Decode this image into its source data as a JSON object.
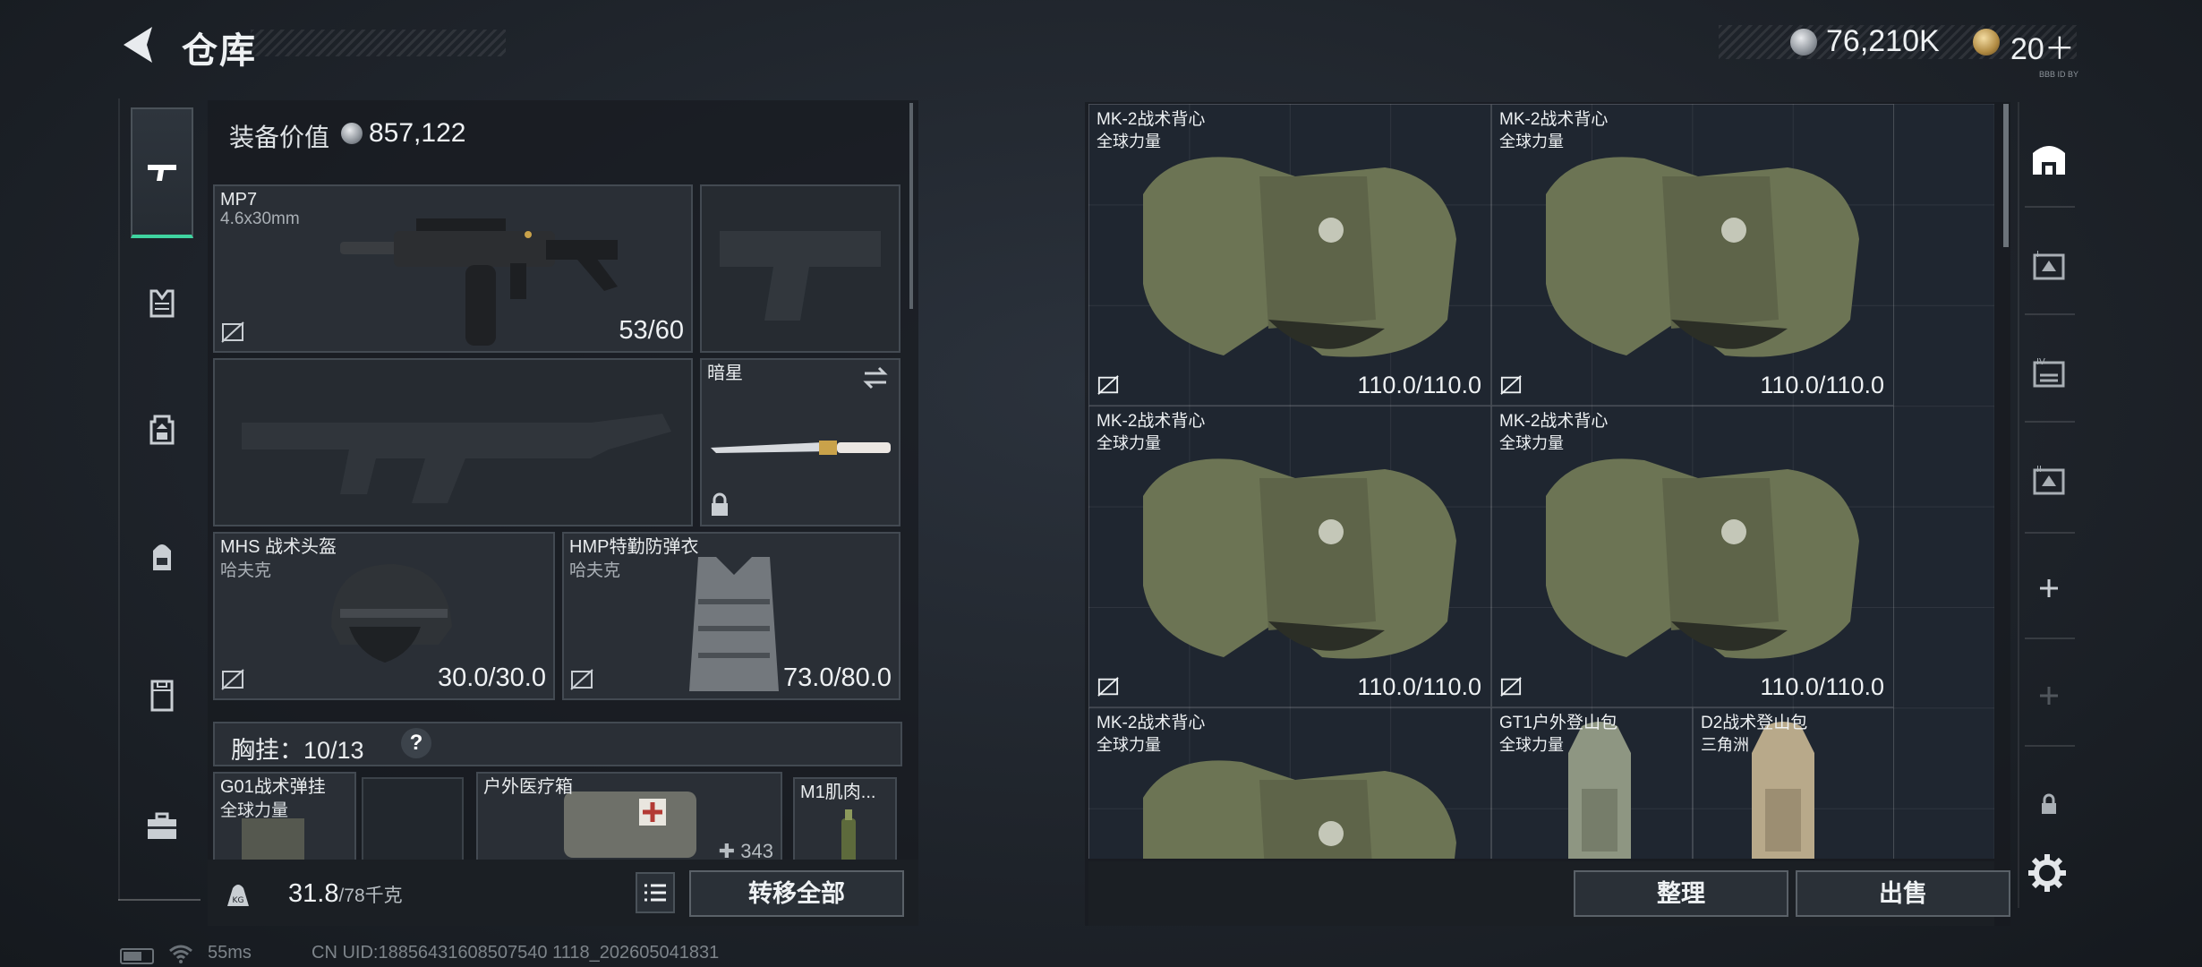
{
  "header": {
    "title": "仓库",
    "currency_amount": "76,210K",
    "coupon_amount": "20＋",
    "tiny_label": "BBB ID BY"
  },
  "left_nav": {
    "items": [
      "weapon-icon",
      "vest-icon",
      "rig-icon",
      "backpack-icon",
      "container-icon",
      "toolbox-icon"
    ],
    "selected": "weapon-icon"
  },
  "equipment": {
    "value_label": "装备价值",
    "value": "857,122",
    "primary": {
      "name": "MP7",
      "caliber": "4.6x30mm",
      "ammo": "53/60"
    },
    "melee": {
      "name": "暗星"
    },
    "helmet": {
      "name": "MHS 战术头盔",
      "brand": "哈夫克",
      "durability": "30.0/30.0"
    },
    "armor": {
      "name": "HMP特勤防弹衣",
      "brand": "哈夫克",
      "durability": "73.0/80.0"
    },
    "rig": {
      "label": "胸挂：",
      "capacity": "10/13",
      "help": "?"
    },
    "rig_items": [
      {
        "name": "G01战术弹挂",
        "brand": "全球力量"
      },
      {
        "name": "户外医疗箱",
        "count": "343"
      },
      {
        "name": "M1肌肉..."
      }
    ]
  },
  "footer": {
    "weight": "31.8",
    "weight_max": "/78千克",
    "transfer_all": "转移全部"
  },
  "storage": {
    "items": [
      {
        "name": "MK-2战术背心",
        "brand": "全球力量",
        "durability": "110.0/110.0"
      },
      {
        "name": "MK-2战术背心",
        "brand": "全球力量",
        "durability": "110.0/110.0"
      },
      {
        "name": "MK-2战术背心",
        "brand": "全球力量",
        "durability": "110.0/110.0"
      },
      {
        "name": "MK-2战术背心",
        "brand": "全球力量",
        "durability": "110.0/110.0"
      },
      {
        "name": "MK-2战术背心",
        "brand": "全球力量"
      },
      {
        "name": "GT1户外登山包",
        "brand": "全球力量"
      },
      {
        "name": "D2战术登山包",
        "brand": "三角洲"
      }
    ],
    "sort_label": "整理",
    "sell_label": "出售"
  },
  "right_nav": {
    "items": [
      "warehouse-icon",
      "storage-tab-1-icon",
      "storage-tab-4-icon",
      "storage-tab-2-icon",
      "add-icon",
      "add-disabled-icon",
      "lock-icon",
      "settings-icon"
    ]
  },
  "status": {
    "ping": "55ms",
    "uid": "CN UID:18856431608507540 1118_202605041831"
  },
  "colors": {
    "accent": "#3fd4a0",
    "background": "#1f242b",
    "panel": "#2a2f36"
  }
}
